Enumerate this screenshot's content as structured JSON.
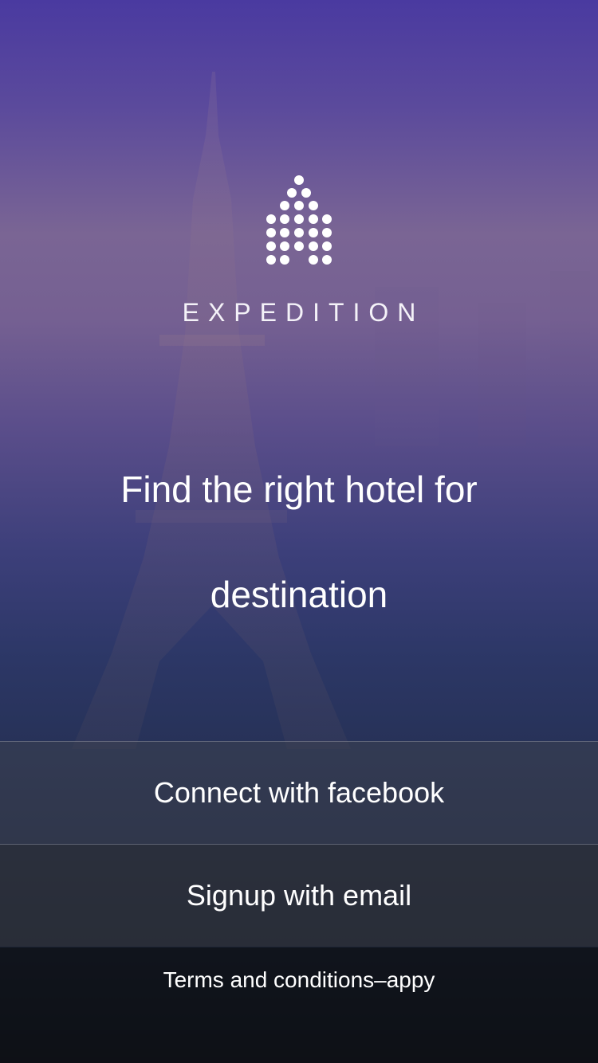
{
  "brand": {
    "name": "EXPEDITION",
    "logo_icon": "hotel-dots-icon"
  },
  "hero": {
    "headline_line1": "Find the right hotel for",
    "headline_line2": "destination"
  },
  "actions": {
    "facebook_label": "Connect with facebook",
    "email_label": "Signup with email"
  },
  "footer": {
    "terms_label": "Terms and conditions–appy"
  },
  "colors": {
    "top": "#4a3aa0",
    "middle": "#2c3766",
    "bottom": "#14171f",
    "text": "#ffffff"
  }
}
